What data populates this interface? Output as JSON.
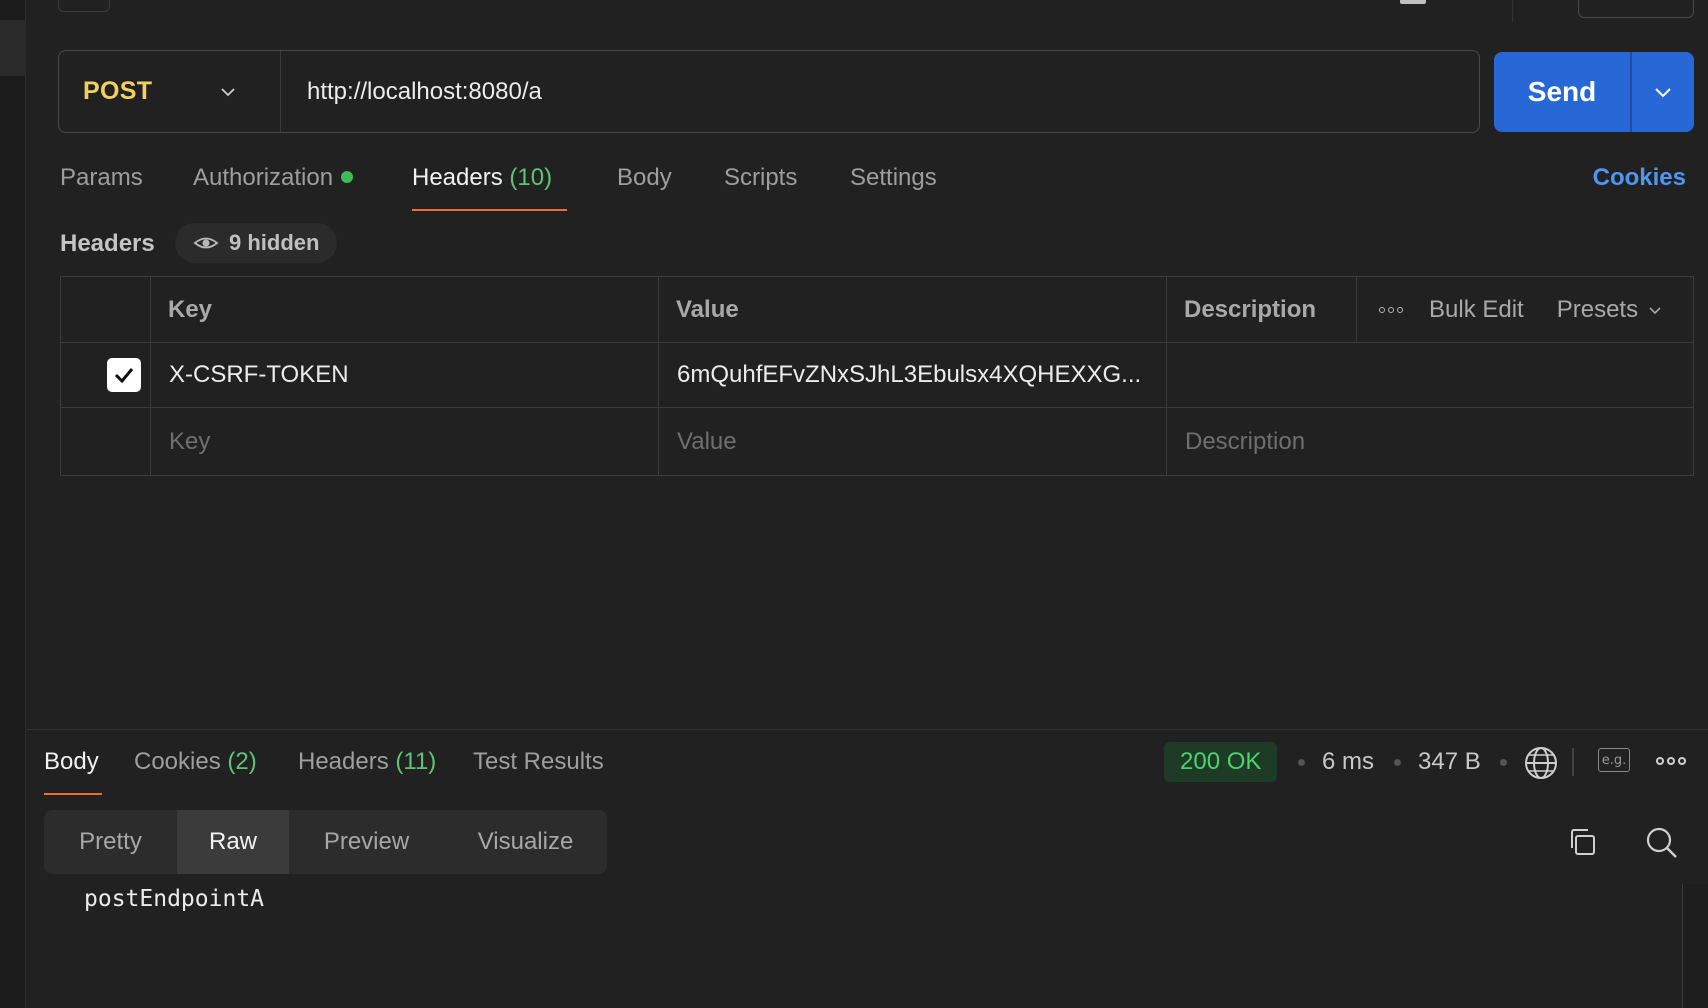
{
  "request": {
    "method": "POST",
    "url": "http://localhost:8080/a",
    "send_label": "Send"
  },
  "request_tabs": {
    "params": "Params",
    "authorization": "Authorization",
    "headers": "Headers",
    "headers_count": "(10)",
    "body": "Body",
    "scripts": "Scripts",
    "settings": "Settings",
    "cookies": "Cookies"
  },
  "headers_section": {
    "title": "Headers",
    "hidden_label": "9 hidden",
    "columns": {
      "key": "Key",
      "value": "Value",
      "description": "Description"
    },
    "tools": {
      "bulk_edit": "Bulk Edit",
      "presets": "Presets"
    },
    "rows": [
      {
        "checked": true,
        "key": "X-CSRF-TOKEN",
        "value": "6mQuhfEFvZNxSJhL3Ebulsx4XQHEXXG...",
        "description": ""
      }
    ],
    "placeholders": {
      "key": "Key",
      "value": "Value",
      "description": "Description"
    }
  },
  "response": {
    "tabs": {
      "body": "Body",
      "cookies": "Cookies",
      "cookies_count": "(2)",
      "headers": "Headers",
      "headers_count": "(11)",
      "test_results": "Test Results"
    },
    "status": "200 OK",
    "time": "6 ms",
    "size": "347 B",
    "example_label": "e.g.",
    "view_modes": [
      "Pretty",
      "Raw",
      "Preview",
      "Visualize"
    ],
    "active_view": "Raw",
    "body": "postEndpointA"
  },
  "colors": {
    "method": "#f2cf62",
    "send": "#2767d6",
    "accent_underline": "#f06b3c",
    "count_green": "#5fc46f",
    "status_green": "#4fd16b",
    "link_blue": "#4f96f0"
  },
  "icons": [
    "chevron-down-icon",
    "eye-icon",
    "check-icon",
    "more-horizontal-icon",
    "globe-icon",
    "copy-icon",
    "search-icon"
  ]
}
